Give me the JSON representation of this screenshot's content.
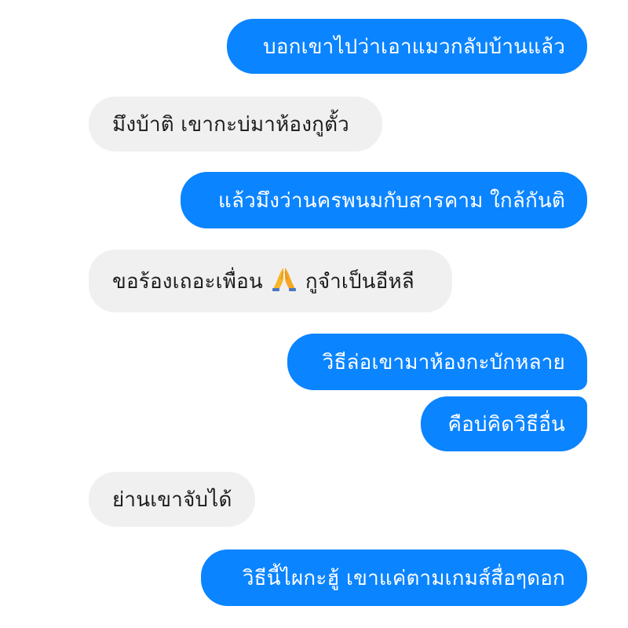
{
  "messages": [
    {
      "id": "b1",
      "direction": "outgoing",
      "text": "บอกเขาไปว่าเอาแมวกลับบ้านแล้ว"
    },
    {
      "id": "b2",
      "direction": "incoming",
      "text": "มึงบ้าติ เขากะบ่มาห้องกูตั้ว"
    },
    {
      "id": "b3",
      "direction": "outgoing",
      "text": "แล้วมึงว่านครพนมกับสารคาม ใกล้กันติ"
    },
    {
      "id": "b4",
      "direction": "incoming",
      "text_before": "ขอร้องเถอะเพื่อน",
      "emoji": "folded-hands-icon",
      "text_after": "กูจำเป็นอีหลี"
    },
    {
      "id": "b5",
      "direction": "outgoing",
      "text": "วิธีล่อเขามาห้องกะบักหลาย"
    },
    {
      "id": "b6",
      "direction": "outgoing",
      "text": "คือบ่คิดวิธีอื่น"
    },
    {
      "id": "b7",
      "direction": "incoming",
      "text": "ย่านเขาจับได้"
    },
    {
      "id": "b8",
      "direction": "outgoing",
      "text": "วิธีนี้ไผกะฮู้ เขาแค่ตามเกมส์สื่อๆดอก"
    }
  ],
  "colors": {
    "outgoing_bg": "#0b84ff",
    "outgoing_text": "#ffffff",
    "incoming_bg": "#f0f0f0",
    "incoming_text": "#1c1c1c"
  }
}
